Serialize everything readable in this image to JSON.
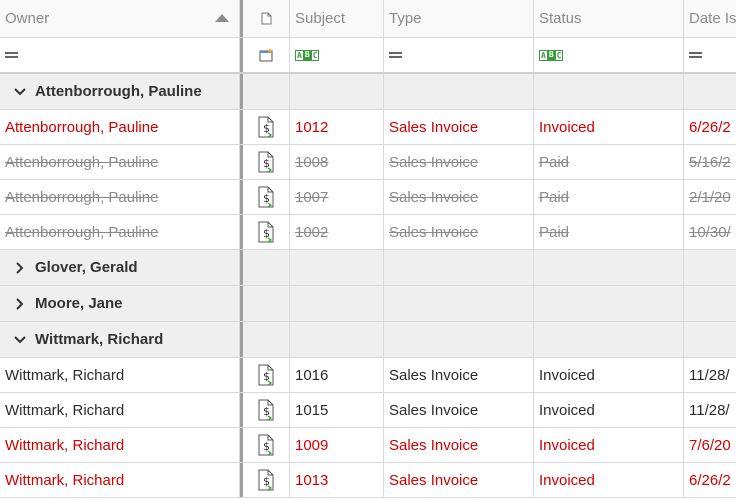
{
  "columns": {
    "owner": "Owner",
    "subject": "Subject",
    "type": "Type",
    "status": "Status",
    "date": "Date Is"
  },
  "groups": [
    {
      "name": "Attenborrough, Pauline",
      "expanded": true,
      "rows": [
        {
          "owner": "Attenborrough, Pauline",
          "subject": "1012",
          "type": "Sales Invoice",
          "status": "Invoiced",
          "date": "6/26/2",
          "style": "red"
        },
        {
          "owner": "Attenborrough, Pauline",
          "subject": "1008",
          "type": "Sales Invoice",
          "status": "Paid",
          "date": "5/16/2",
          "style": "strike"
        },
        {
          "owner": "Attenborrough, Pauline",
          "subject": "1007",
          "type": "Sales Invoice",
          "status": "Paid",
          "date": "2/1/20",
          "style": "strike"
        },
        {
          "owner": "Attenborrough, Pauline",
          "subject": "1002",
          "type": "Sales Invoice",
          "status": "Paid",
          "date": "10/30/",
          "style": "strike"
        }
      ]
    },
    {
      "name": "Glover, Gerald",
      "expanded": false,
      "rows": []
    },
    {
      "name": "Moore, Jane",
      "expanded": false,
      "rows": []
    },
    {
      "name": "Wittmark, Richard",
      "expanded": true,
      "rows": [
        {
          "owner": "Wittmark, Richard",
          "subject": "1016",
          "type": "Sales Invoice",
          "status": "Invoiced",
          "date": "11/28/",
          "style": "normal"
        },
        {
          "owner": "Wittmark, Richard",
          "subject": "1015",
          "type": "Sales Invoice",
          "status": "Invoiced",
          "date": "11/28/",
          "style": "normal"
        },
        {
          "owner": "Wittmark, Richard",
          "subject": "1009",
          "type": "Sales Invoice",
          "status": "Invoiced",
          "date": "7/6/20",
          "style": "red"
        },
        {
          "owner": "Wittmark, Richard",
          "subject": "1013",
          "type": "Sales Invoice",
          "status": "Invoiced",
          "date": "6/26/2",
          "style": "red"
        }
      ]
    }
  ],
  "colors": {
    "overdue": "#d00000",
    "paid": "#8a8a8a",
    "group_bg": "#efefef"
  },
  "icons": {
    "row": "document-dollar-icon",
    "header": "page-icon"
  }
}
